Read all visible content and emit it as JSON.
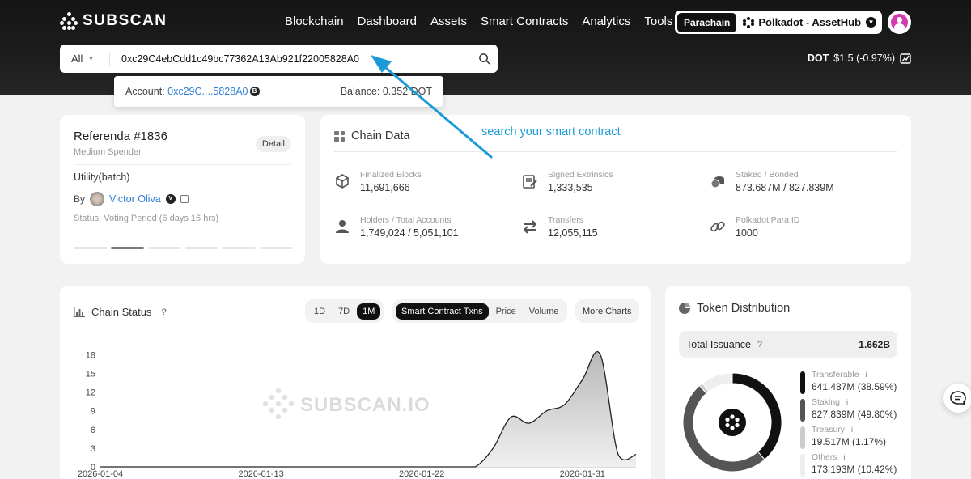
{
  "brand": {
    "name": "SUBSCAN"
  },
  "nav": [
    "Blockchain",
    "Dashboard",
    "Assets",
    "Smart Contracts",
    "Analytics",
    "Tools"
  ],
  "network": {
    "tag": "Parachain",
    "name": "Polkadot - AssetHub"
  },
  "search": {
    "type": "All",
    "value": "0xc29C4ebCdd1c49bc77362A13Ab921f22005828A0",
    "suggestion": {
      "account_label": "Account:",
      "account_short": "0xc29C....5828A0",
      "balance_label": "Balance:",
      "balance_value": "0.352 DOT"
    }
  },
  "price": {
    "symbol": "DOT",
    "value": "$1.5 (-0.97%)"
  },
  "annotation": "search your smart contract",
  "referenda": {
    "title": "Referenda #1836",
    "subtitle": "Medium Spender",
    "detail_label": "Detail",
    "call": "Utility(batch)",
    "by_label": "By",
    "proposer": "Victor Oliva",
    "status": "Status:  Voting Period (6 days 16 hrs)",
    "pager_total": 6,
    "pager_active": 2
  },
  "chain_data": {
    "title": "Chain Data",
    "stats": [
      {
        "label": "Finalized Blocks",
        "value": "11,691,666",
        "icon": "cube-icon"
      },
      {
        "label": "Signed Extrinsics",
        "value": "1,333,535",
        "icon": "document-sign-icon"
      },
      {
        "label": "Staked / Bonded",
        "value": "873.687M / 827.839M",
        "icon": "coins-icon"
      },
      {
        "label": "Holders / Total Accounts",
        "value": "1,749,024 / 5,051,101",
        "icon": "user-icon"
      },
      {
        "label": "Transfers",
        "value": "12,055,115",
        "icon": "transfer-arrows-icon"
      },
      {
        "label": "Polkadot Para ID",
        "value": "1000",
        "icon": "link-icon"
      }
    ]
  },
  "chain_status": {
    "title": "Chain Status",
    "help": "?",
    "ranges": [
      "1D",
      "7D",
      "1M"
    ],
    "active_range": "1M",
    "metrics": [
      "Smart Contract Txns",
      "Price",
      "Volume"
    ],
    "active_metric": "Smart Contract Txns",
    "more_label": "More Charts",
    "watermark": "SUBSCAN.IO"
  },
  "chart_data": {
    "type": "area",
    "x_ticks": [
      "2026-01-04",
      "2026-01-13",
      "2026-01-22",
      "2026-01-31"
    ],
    "y_ticks": [
      0,
      3,
      6,
      9,
      12,
      15,
      18
    ],
    "ylim": [
      0,
      20
    ],
    "x": [
      "2026-01-04",
      "2026-01-05",
      "2026-01-06",
      "2026-01-07",
      "2026-01-08",
      "2026-01-09",
      "2026-01-10",
      "2026-01-11",
      "2026-01-12",
      "2026-01-13",
      "2026-01-14",
      "2026-01-15",
      "2026-01-16",
      "2026-01-17",
      "2026-01-18",
      "2026-01-19",
      "2026-01-20",
      "2026-01-21",
      "2026-01-22",
      "2026-01-23",
      "2026-01-24",
      "2026-01-25",
      "2026-01-26",
      "2026-01-27",
      "2026-01-28",
      "2026-01-29",
      "2026-01-30",
      "2026-01-31",
      "2026-02-01",
      "2026-02-02",
      "2026-02-03"
    ],
    "values": [
      0,
      0,
      0,
      0,
      0,
      0,
      0,
      0,
      0,
      0,
      0,
      0,
      0,
      0,
      0,
      0,
      0,
      0,
      0,
      0,
      0,
      0,
      3,
      8,
      7,
      9,
      10,
      14,
      18,
      2,
      2
    ],
    "grid": false,
    "color": "#cfcfcf"
  },
  "token": {
    "title": "Token Distribution",
    "issuance_label": "Total Issuance",
    "issuance_help": "?",
    "issuance_value": "1.662B",
    "legend": [
      {
        "label": "Transferable",
        "value": "641.487M (38.59%)",
        "pct": 38.59,
        "color": "#111111"
      },
      {
        "label": "Staking",
        "value": "827.839M (49.80%)",
        "pct": 49.8,
        "color": "#555555"
      },
      {
        "label": "Treasury",
        "value": "19.517M (1.17%)",
        "pct": 1.17,
        "color": "#cccccc"
      },
      {
        "label": "Others",
        "value": "173.193M (10.42%)",
        "pct": 10.42,
        "color": "#eeeeee"
      }
    ]
  }
}
